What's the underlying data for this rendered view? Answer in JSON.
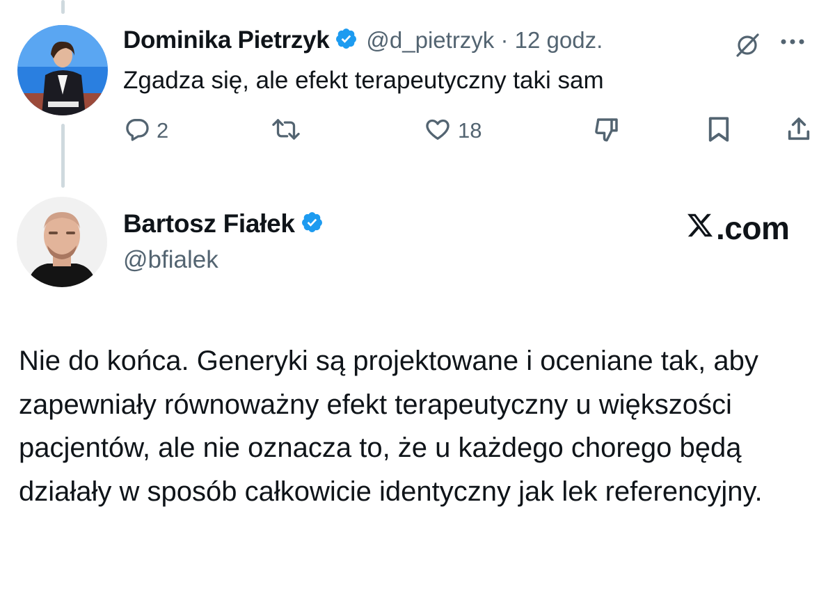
{
  "reply": {
    "author_name": "Dominika Pietrzyk",
    "handle_meta": "@d_pietrzyk · 12 godz.",
    "text": "Zgadza się, ale efekt terapeutyczny taki sam",
    "replies_count": "2",
    "likes_count": "18"
  },
  "main_post": {
    "author_name": "Bartosz Fiałek",
    "handle": "@bfialek",
    "site_label": ".com",
    "text": "Nie do końca. Generyki są projektowane i oceniane tak, aby zapewniały równoważny efekt terapeutyczny u większości pacjentów, ale nie oznacza to, że u każdego chorego będą działały w sposób całkowicie identyczny jak lek referencyjny."
  },
  "icons": {
    "verified": "verified-badge-icon",
    "grok": "grok-icon",
    "more": "more-icon",
    "reply": "reply-icon",
    "repost": "repost-icon",
    "like": "like-icon",
    "dislike": "dislike-icon",
    "bookmark": "bookmark-icon",
    "share": "share-icon",
    "x_logo": "x-logo-icon"
  },
  "colors": {
    "verified_blue": "#1d9bf0",
    "text_primary": "#0f1419",
    "text_secondary": "#536471",
    "thread_line": "#cfd9de"
  }
}
